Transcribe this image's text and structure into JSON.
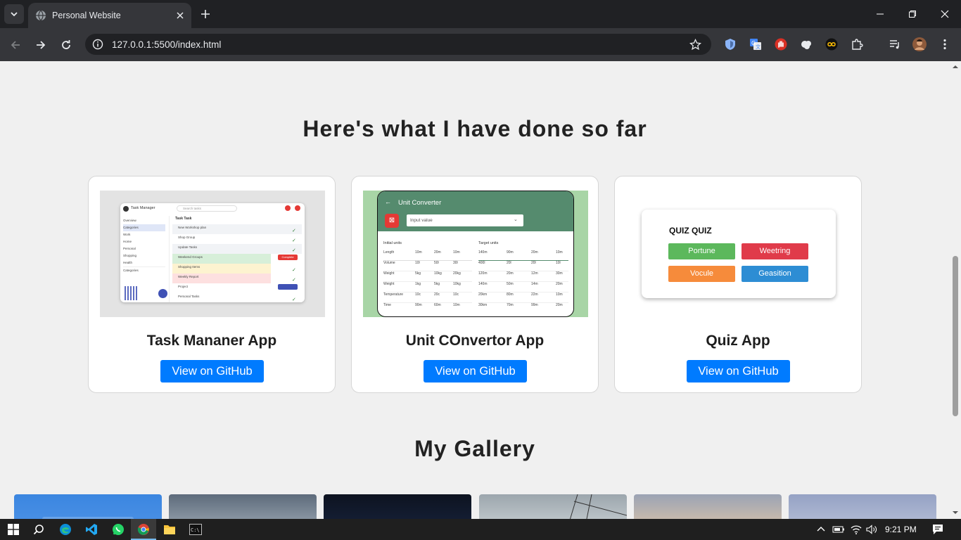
{
  "browser": {
    "tab_title": "Personal Website",
    "url": "127.0.0.1:5500/index.html"
  },
  "projects": {
    "title": "Here's what I have done so far",
    "cards": [
      {
        "name": "Task Mananer App",
        "button": "View on GitHub"
      },
      {
        "name": "Unit COnvertor App",
        "button": "View on GitHub"
      },
      {
        "name": "Quiz App",
        "button": "View on GitHub"
      }
    ]
  },
  "task_thumb": {
    "app_title": "Task Manager",
    "search_placeholder": "Search tasks",
    "list_header": "Task Task",
    "sidebar": [
      "Overview",
      "Categories",
      "Work",
      "Home",
      "Personal",
      "Shopping",
      "Health"
    ],
    "sidebar_section": "Categories",
    "tasks": [
      "New Workshop plan",
      "Shop Group",
      "Update Tasks",
      "Weekend Groups",
      "Shopping Items",
      "Weekly Report",
      "Project",
      "Personal Tasks"
    ],
    "complete_label": "Complete"
  },
  "unit_thumb": {
    "title": "Unit Converter",
    "input_placeholder": "Input value",
    "left_header": "Initial units",
    "right_header": "Target units",
    "left_rows": [
      "Length",
      "Volume",
      "Weight",
      "Weight",
      "Temperature",
      "Time"
    ],
    "left_values": [
      [
        "10m",
        "20m",
        "10m"
      ],
      [
        "10l",
        "50l",
        "30l"
      ],
      [
        "5kg",
        "10kg",
        "20kg"
      ],
      [
        "1kg",
        "5kg",
        "10kg"
      ],
      [
        "10c",
        "20c",
        "10c"
      ],
      [
        "90m",
        "60m",
        "10m"
      ]
    ],
    "right_values": [
      [
        "140m",
        "90m",
        "20m",
        "10m"
      ],
      [
        "400l",
        "20l",
        "20l",
        "10l"
      ],
      [
        "120m",
        "20m",
        "12m",
        "30m"
      ],
      [
        "140m",
        "50m",
        "14m",
        "20m"
      ],
      [
        "20km",
        "80m",
        "22m",
        "10m"
      ],
      [
        "30km",
        "70m",
        "99m",
        "20m"
      ]
    ]
  },
  "quiz_thumb": {
    "title": "QUIZ QUIZ",
    "options": [
      "Portune",
      "Weetring",
      "Vocule",
      "Geasition"
    ]
  },
  "gallery": {
    "title": "My Gallery"
  },
  "taskbar": {
    "time": "9:21 PM"
  }
}
